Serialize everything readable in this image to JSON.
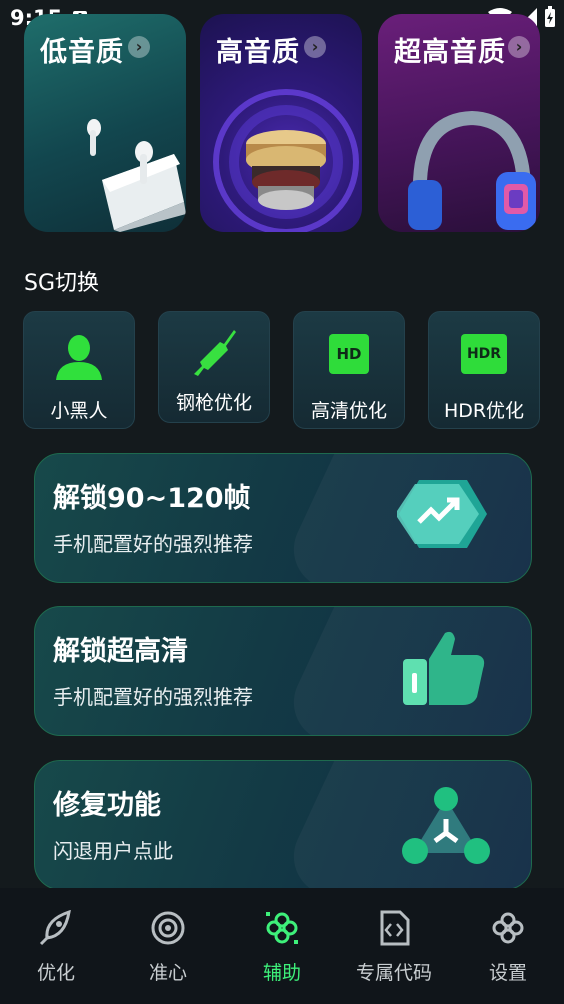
{
  "status_bar": {
    "time": "9:15",
    "notification_icon": "A"
  },
  "quality_cards": [
    {
      "label": "低音质",
      "image": "earbuds"
    },
    {
      "label": "高音质",
      "image": "speaker-driver"
    },
    {
      "label": "超高音质",
      "image": "headphones"
    }
  ],
  "sg_section": {
    "title": "SG切换",
    "items": [
      {
        "label": "小黑人",
        "icon": "person-icon"
      },
      {
        "label": "钢枪优化",
        "icon": "rifle-icon"
      },
      {
        "label": "高清优化",
        "icon": "hd-icon",
        "badge": "HD"
      },
      {
        "label": "HDR优化",
        "icon": "hdr-icon",
        "badge": "HDR"
      }
    ]
  },
  "features": [
    {
      "title": "解锁90~120帧",
      "subtitle": "手机配置好的强烈推荐",
      "icon": "trend-hexagon-icon"
    },
    {
      "title": "解锁超高清",
      "subtitle": "手机配置好的强烈推荐",
      "icon": "thumbs-up-icon"
    },
    {
      "title": "修复功能",
      "subtitle": "闪退用户点此",
      "icon": "network-nodes-icon"
    }
  ],
  "bottom_nav": [
    {
      "label": "优化",
      "icon": "rocket-icon"
    },
    {
      "label": "准心",
      "icon": "crosshair-icon"
    },
    {
      "label": "辅助",
      "icon": "plus-cluster-icon",
      "active": true
    },
    {
      "label": "专属代码",
      "icon": "code-file-icon"
    },
    {
      "label": "设置",
      "icon": "settings-icon"
    }
  ],
  "colors": {
    "accent": "#3ef07a",
    "background": "#141a1d"
  }
}
